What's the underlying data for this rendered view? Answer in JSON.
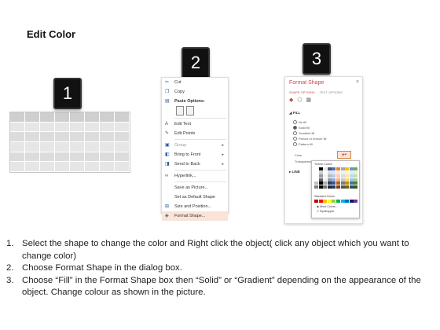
{
  "title": "Edit Color",
  "badges": [
    "1",
    "2",
    "3"
  ],
  "menu": {
    "items": [
      {
        "label": "Cut",
        "icon": "scissors-icon",
        "glyph": "✂"
      },
      {
        "label": "Copy",
        "icon": "copy-icon",
        "glyph": "❐"
      },
      {
        "label": "Paste Options:",
        "icon": "paste-icon",
        "glyph": "📋"
      },
      {
        "label": "Edit Text",
        "icon": "edit-text-icon",
        "glyph": "A"
      },
      {
        "label": "Edit Points",
        "icon": "edit-points-icon",
        "glyph": "✎"
      },
      {
        "label": "Group",
        "icon": "group-icon",
        "glyph": "▣",
        "arrow": "▸"
      },
      {
        "label": "Bring to Front",
        "icon": "bring-front-icon",
        "glyph": "◧",
        "arrow": "▸"
      },
      {
        "label": "Send to Back",
        "icon": "send-back-icon",
        "glyph": "◨",
        "arrow": "▸"
      },
      {
        "label": "Hyperlink...",
        "icon": "hyperlink-icon",
        "glyph": "🔗"
      },
      {
        "label": "Save as Picture...",
        "icon": "",
        "glyph": ""
      },
      {
        "label": "Set as Default Shape",
        "icon": "",
        "glyph": ""
      },
      {
        "label": "Size and Position...",
        "icon": "size-position-icon",
        "glyph": "⊞"
      },
      {
        "label": "Format Shape...",
        "icon": "format-shape-icon",
        "glyph": "◈"
      }
    ]
  },
  "pane": {
    "title": "Format Shape",
    "close": "×",
    "tabs": [
      "SHAPE OPTIONS",
      "TEXT OPTIONS"
    ],
    "section_fill": "◢ FILL",
    "options": [
      "No fill",
      "Solid fill",
      "Gradient fill",
      "Picture or texture fill",
      "Pattern fill"
    ],
    "color_label": "Color",
    "transparency_label": "Transparency",
    "section_line": "▸ LINE"
  },
  "palette": {
    "theme_label": "Theme Colors",
    "standard_label": "Standard Colors",
    "more": "More Colors...",
    "eyedropper": "Eyedropper",
    "theme_colors": [
      "#ffffff",
      "#000000",
      "#e7e6e6",
      "#44546a",
      "#4472c4",
      "#ed7d31",
      "#a5a5a5",
      "#ffc000",
      "#5b9bd5",
      "#70ad47"
    ],
    "standard_colors": [
      "#c00000",
      "#ff0000",
      "#ffc000",
      "#ffff00",
      "#92d050",
      "#00b050",
      "#00b0f0",
      "#0070c0",
      "#002060",
      "#7030a0"
    ]
  },
  "instructions": [
    {
      "num": "1.",
      "text": "Select the shape to change the color and Right click the object( click any object which you want to change color)"
    },
    {
      "num": "2.",
      "text": "Choose Format Shape in the dialog box."
    },
    {
      "num": "3.",
      "text": "Choose “Fill” in the Format Shape box then “Solid” or “Gradient” depending on the appearance of the object. Change colour as shown in the picture."
    }
  ]
}
